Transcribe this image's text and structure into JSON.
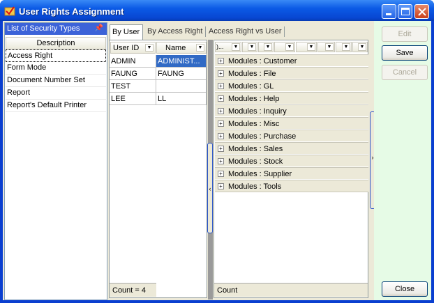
{
  "window": {
    "title": "User Rights Assignment"
  },
  "left_panel": {
    "header": "List of Security Types",
    "column": "Description",
    "items": [
      "Access Right",
      "Form Mode",
      "Document Number Set",
      "Report",
      "Report's Default Printer"
    ],
    "selected": "Access Right"
  },
  "tabs": [
    "By User",
    "By Access Right",
    "Access Right vs User"
  ],
  "active_tab": "By User",
  "user_grid": {
    "columns": [
      "User ID",
      "Name"
    ],
    "rows": [
      {
        "user_id": "ADMIN",
        "name": "ADMINIST..."
      },
      {
        "user_id": "FAUNG",
        "name": "FAUNG"
      },
      {
        "user_id": "TEST",
        "name": ""
      },
      {
        "user_id": "LEE",
        "name": "LL"
      }
    ],
    "count_label": "Count = 4"
  },
  "module_grid": {
    "first_header": ")...",
    "groups": [
      "Modules : Customer",
      "Modules : File",
      "Modules : GL",
      "Modules : Help",
      "Modules : Inquiry",
      "Modules : Misc",
      "Modules : Purchase",
      "Modules : Sales",
      "Modules : Stock",
      "Modules : Supplier",
      "Modules : Tools"
    ],
    "count_label": "Count"
  },
  "buttons": {
    "edit": "Edit",
    "save": "Save",
    "cancel": "Cancel",
    "close": "Close"
  },
  "colors": {
    "titlebar": "#0b5ae6",
    "selection": "#316ac5",
    "panel_green": "#e6fbe6"
  }
}
